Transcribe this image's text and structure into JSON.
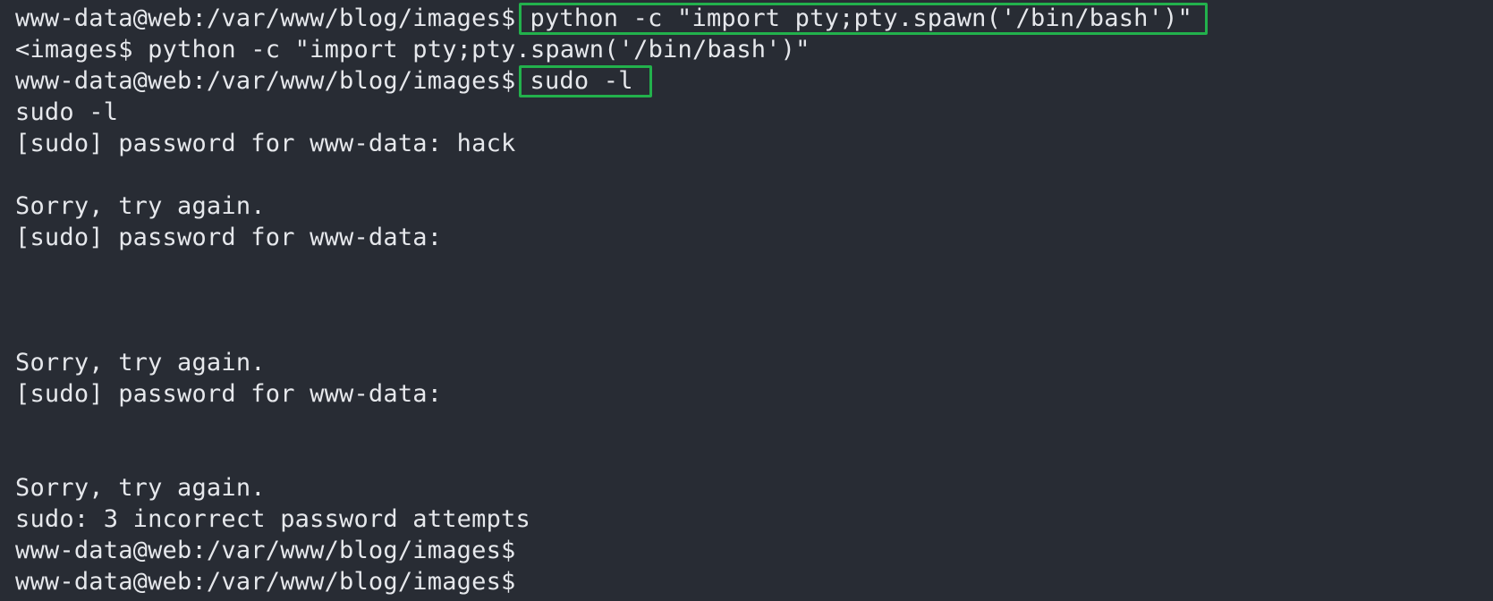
{
  "terminal": {
    "prompt": "www-data@web:/var/www/blog/images$",
    "lines": {
      "l0_prompt": "www-data@web:/var/www/blog/images$",
      "l0_cmd": "python -c \"import pty;pty.spawn('/bin/bash')\"",
      "l1": "<images$ python -c \"import pty;pty.spawn('/bin/bash')\"",
      "l2_prompt": "www-data@web:/var/www/blog/images$",
      "l2_cmd": "sudo -l",
      "l3": "sudo -l",
      "l4": "[sudo] password for www-data: hack",
      "l5": "",
      "l6": "Sorry, try again.",
      "l7": "[sudo] password for www-data:",
      "l8": "",
      "l9": "",
      "l10": "",
      "l11": "Sorry, try again.",
      "l12": "[sudo] password for www-data:",
      "l13": "",
      "l14": "",
      "l15": "Sorry, try again.",
      "l16": "sudo: 3 incorrect password attempts",
      "l17": "www-data@web:/var/www/blog/images$",
      "l18": "www-data@web:/var/www/blog/images$"
    },
    "highlight_color": "#22b14c",
    "background_color": "#282c34",
    "text_color": "#e6e8ec"
  }
}
